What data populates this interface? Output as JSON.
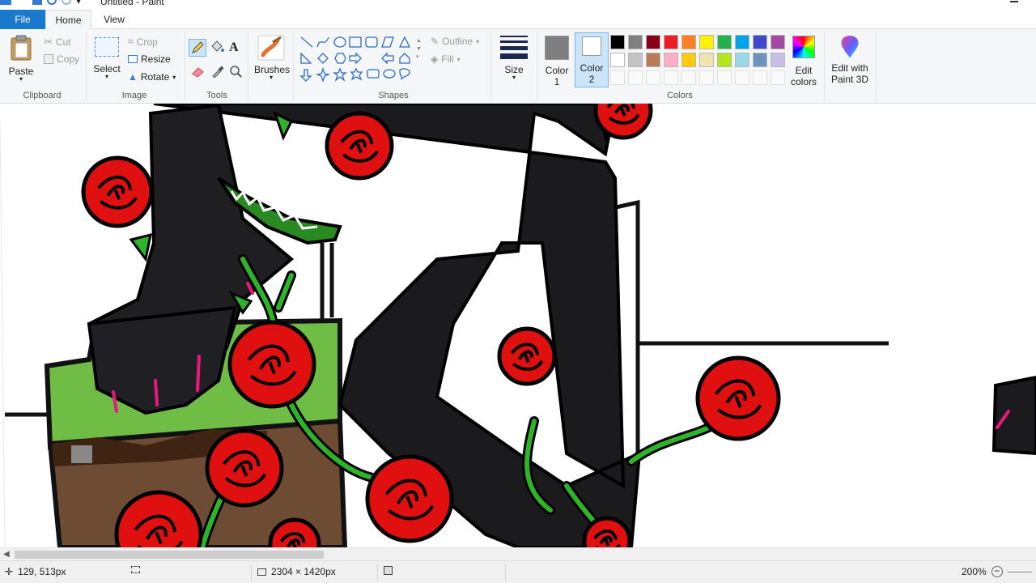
{
  "window": {
    "title": "Untitled - Paint"
  },
  "tabs": {
    "file": "File",
    "home": "Home",
    "view": "View"
  },
  "clipboard": {
    "label": "Clipboard",
    "paste": "Paste",
    "cut": "Cut",
    "copy": "Copy"
  },
  "image": {
    "label": "Image",
    "select": "Select",
    "crop": "Crop",
    "resize": "Resize",
    "rotate": "Rotate"
  },
  "tools": {
    "label": "Tools"
  },
  "brushes": {
    "label": "Brushes"
  },
  "shapes": {
    "label": "Shapes",
    "outline": "Outline",
    "fill": "Fill"
  },
  "size": {
    "label": "Size"
  },
  "colors": {
    "label": "Colors",
    "color1_line1": "Color",
    "color1_line2": "1",
    "color2_line1": "Color",
    "color2_line2": "2",
    "color1_value": "#7f7f7f",
    "color2_value": "#ffffff",
    "edit_colors_line1": "Edit",
    "edit_colors_line2": "colors",
    "edit_3d_line1": "Edit with",
    "edit_3d_line2": "Paint 3D",
    "palette_row1": [
      "#000000",
      "#7f7f7f",
      "#880015",
      "#ed1c24",
      "#ff7f27",
      "#fff200",
      "#22b14c",
      "#00a2e8",
      "#3f48cc",
      "#a349a4"
    ],
    "palette_row2": [
      "#ffffff",
      "#c3c3c3",
      "#b97a57",
      "#ffaec9",
      "#ffc90e",
      "#efe4b0",
      "#b5e61d",
      "#99d9ea",
      "#7092be",
      "#c8bfe7"
    ]
  },
  "status": {
    "cursor_pos": "129, 513px",
    "image_size": "2304 × 1420px",
    "zoom": "200%"
  }
}
